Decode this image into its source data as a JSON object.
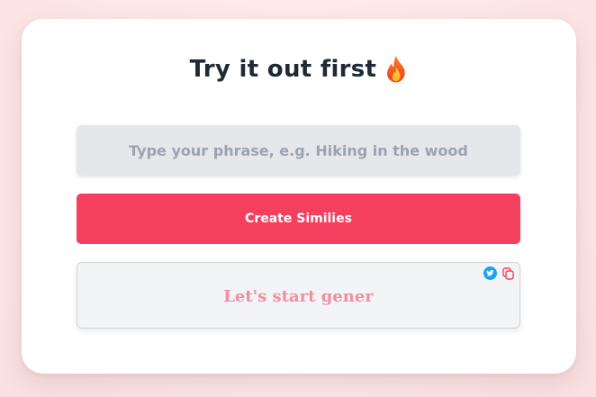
{
  "page": {
    "title": "Try it out first",
    "title_icon": "fire-emoji"
  },
  "form": {
    "input_placeholder": "Type your phrase, e.g. Hiking in the wood",
    "input_value": "",
    "submit_label": "Create Similies"
  },
  "output": {
    "text": "Let's start gener",
    "actions": [
      "twitter-icon",
      "copy-icon"
    ]
  },
  "colors": {
    "primary": "#f43f5e",
    "title": "#1f2a37",
    "input_bg": "#e5e7eb",
    "placeholder": "#9ca3af",
    "output_text": "#f08ea2",
    "twitter": "#1da1f2"
  }
}
